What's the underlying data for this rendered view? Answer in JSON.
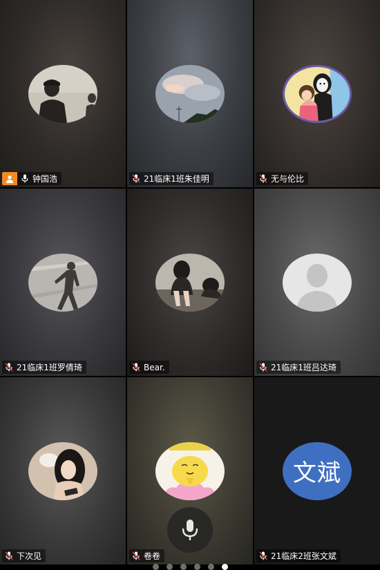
{
  "participants": [
    {
      "name": "钟国浩",
      "mic": "on",
      "is_host": true
    },
    {
      "name": "21临床1班朱佳明",
      "mic": "muted",
      "is_host": false
    },
    {
      "name": "无与伦比",
      "mic": "muted",
      "is_host": false
    },
    {
      "name": "21临床1班罗倩琦",
      "mic": "muted",
      "is_host": false
    },
    {
      "name": "Bear.",
      "mic": "muted",
      "is_host": false
    },
    {
      "name": "21临床1班吕达琦",
      "mic": "muted",
      "is_host": false
    },
    {
      "name": "下次见",
      "mic": "muted",
      "is_host": false
    },
    {
      "name": "卷卷",
      "mic": "muted",
      "is_host": false
    },
    {
      "name": "21临床2班张文斌",
      "mic": "muted",
      "is_host": false,
      "avatar_text": "文斌"
    }
  ],
  "toolbar": {
    "mic_icon": "microphone-icon"
  },
  "pager": {
    "total_pages": 6,
    "current_page": 6
  },
  "colors": {
    "host_badge": "#f08a24",
    "text_avatar": "#3f6fc1",
    "muted_slash": "#e0463c"
  }
}
